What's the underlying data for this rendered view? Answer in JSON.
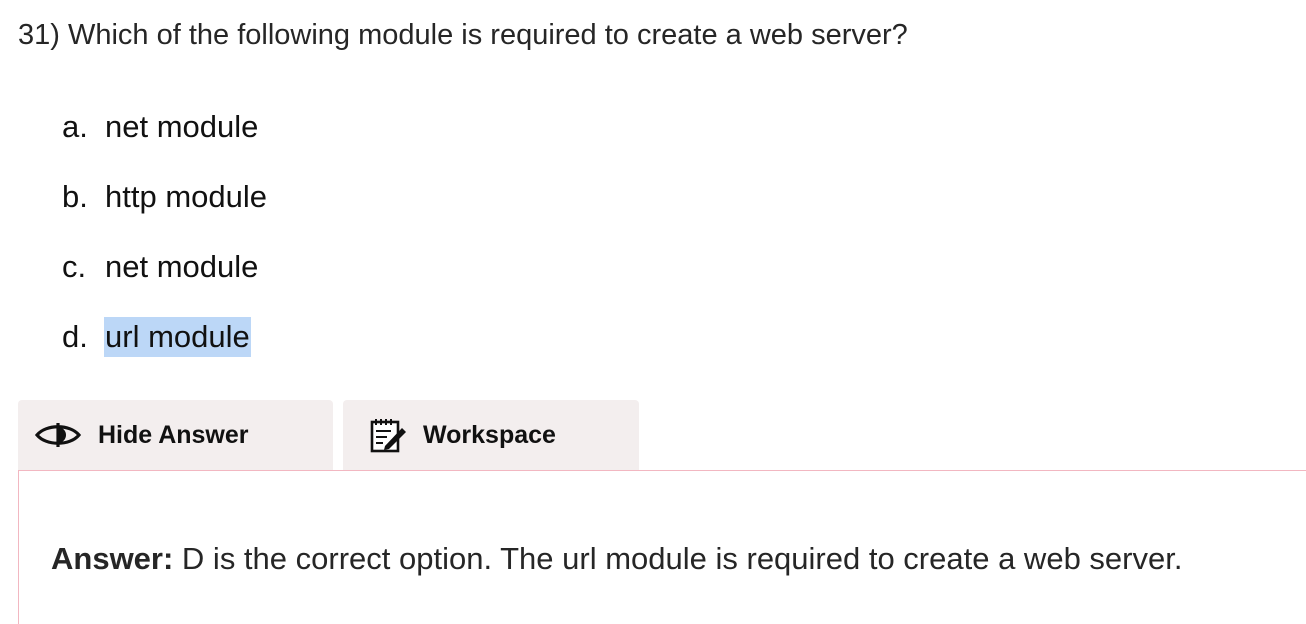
{
  "question": {
    "text": "31) Which of the following module is required to create a web server?"
  },
  "options": [
    {
      "letter": "a.",
      "text": "net module",
      "selected": false
    },
    {
      "letter": "b.",
      "text": "http module",
      "selected": false
    },
    {
      "letter": "c.",
      "text": "net module",
      "selected": false
    },
    {
      "letter": "d.",
      "text": "url module",
      "selected": true
    }
  ],
  "tabs": {
    "hide_answer": {
      "label": "Hide Answer",
      "icon": "eye-icon"
    },
    "workspace": {
      "label": "Workspace",
      "icon": "notepad-pencil-icon"
    }
  },
  "answer": {
    "label": "Answer:",
    "text": " D is the correct option. The url module is required to create a web server."
  },
  "colors": {
    "selection_highlight": "#bcd7f7",
    "tab_background": "#f3eeee",
    "answer_border": "#f2b7c1"
  }
}
